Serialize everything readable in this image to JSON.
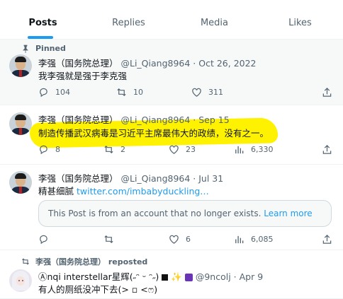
{
  "tabs": [
    {
      "label": "Posts",
      "active": true
    },
    {
      "label": "Replies",
      "active": false
    },
    {
      "label": "Media",
      "active": false
    },
    {
      "label": "Likes",
      "active": false
    }
  ],
  "tweets": [
    {
      "pinned_label": "Pinned",
      "name": "李强（国务院总理）",
      "handle": "@Li_Qiang8964",
      "date": "Oct 26, 2022",
      "text": "我李强就是强于李克强",
      "replies": "104",
      "reposts": "10",
      "likes": "311",
      "views": ""
    },
    {
      "name": "李强（国务院总理）",
      "handle": "@Li_Qiang8964",
      "date": "Sep 15",
      "text": "制造传播武汉病毒是习近平主席最伟大的政绩，没有之一。",
      "replies": "8",
      "reposts": "2",
      "likes": "23",
      "views": "6,330",
      "highlight_color": "#fff200"
    },
    {
      "name": "李强（国务院总理）",
      "handle": "@Li_Qiang8964",
      "date": "Jul 31",
      "text": "精甚细腻",
      "link": "twitter.com/imbabyduckling…",
      "quote_text": "This Post is from an account that no longer exists.",
      "quote_link": "Learn more",
      "replies": "",
      "reposts": "",
      "likes": "6",
      "views": "6,085"
    },
    {
      "repost_label": "李强（国务院总理） reposted",
      "name": "Ⓐnqi interstellar星辉(˶ᵔ ᵕ ᵔ˶)",
      "handle": "@9ncolj",
      "date": "Apr 9",
      "text": "有人的厕纸没冲下去(> ▫ <ෆ)"
    }
  ],
  "separator": " · ",
  "colors": {
    "accent": "#1d9bf0",
    "muted": "#536471",
    "highlight": "#fff200"
  },
  "icons": [
    "pin-icon",
    "reply-icon",
    "repost-icon",
    "like-icon",
    "views-icon",
    "share-icon"
  ]
}
